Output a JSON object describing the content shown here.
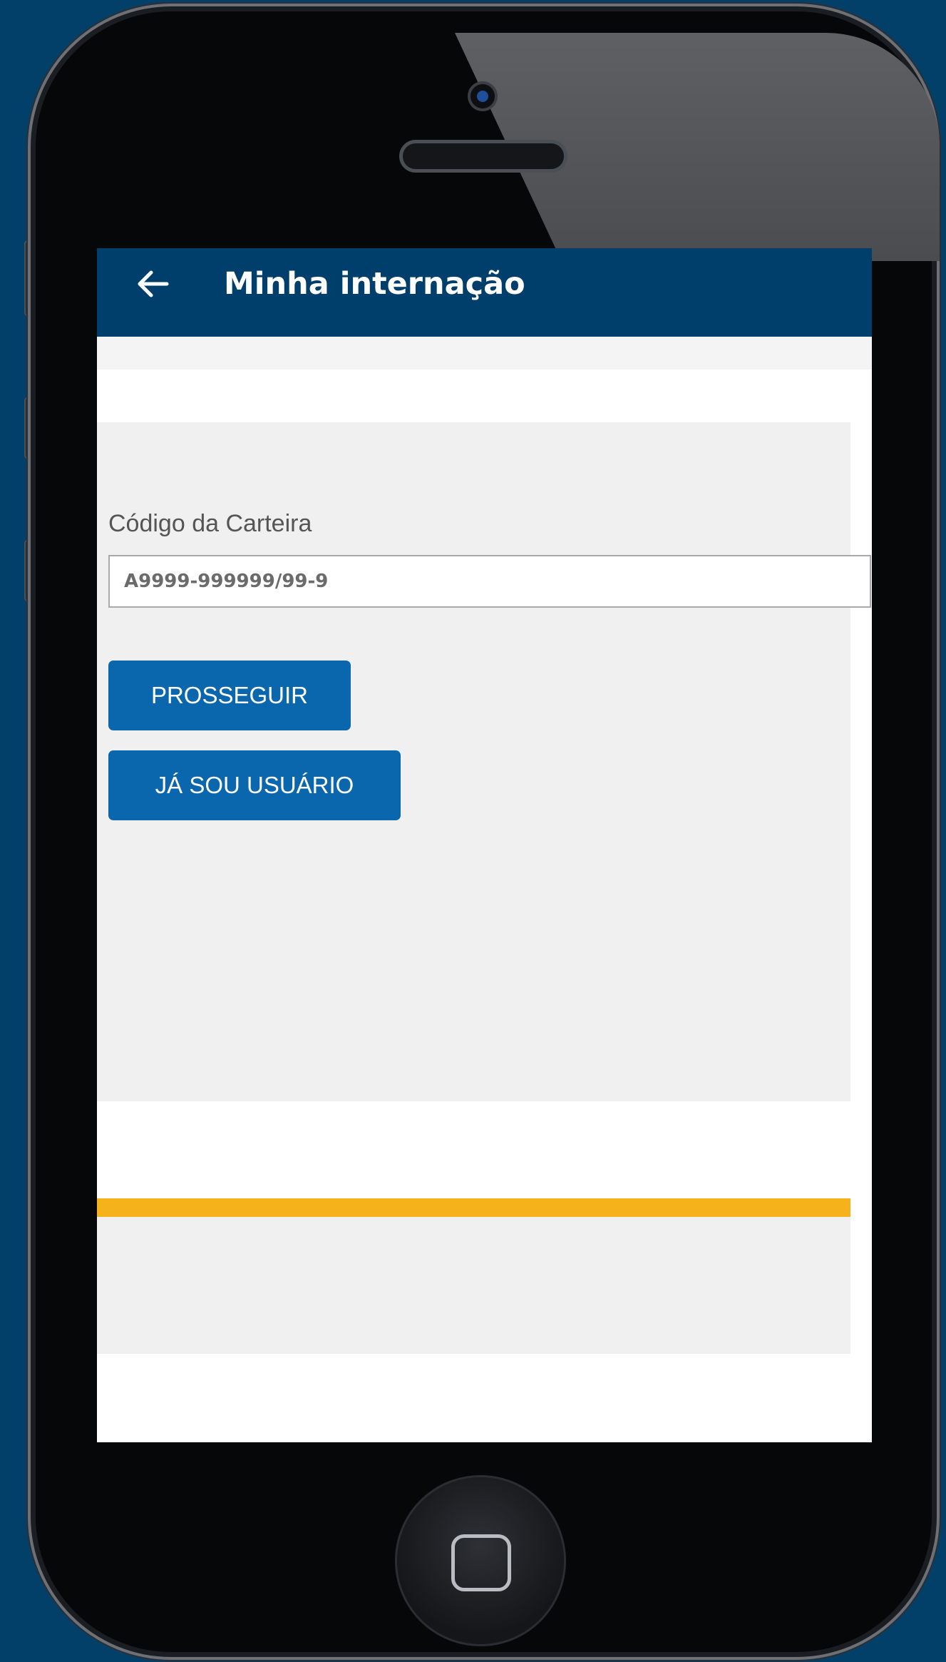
{
  "app_bar": {
    "title": "Minha internação",
    "back_icon": "arrow-left-icon"
  },
  "form": {
    "label": "Código da Carteira",
    "placeholder": "A9999-999999/99-9",
    "value": ""
  },
  "buttons": {
    "proceed_label": "PROSSEGUIR",
    "existing_user_label": "JÁ SOU USUÁRIO"
  },
  "colors": {
    "app_bar": "#003f6b",
    "button": "#0a66ad",
    "accent_bar": "#f5b21b",
    "background": "#034069"
  }
}
